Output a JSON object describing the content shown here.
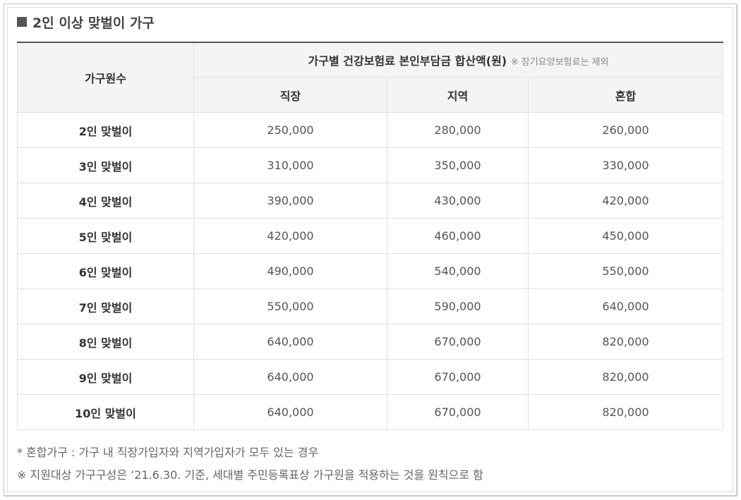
{
  "heading": "2인 이상 맞벌이 가구",
  "table": {
    "row_header_label": "가구원수",
    "group_header": "가구별 건강보험료 본인부담금 합산액(원)",
    "group_note": "※ 장기요양보험료는 제외",
    "columns": [
      "직장",
      "지역",
      "혼합"
    ],
    "rows": [
      {
        "label": "2인 맞벌이",
        "values": [
          "250,000",
          "280,000",
          "260,000"
        ]
      },
      {
        "label": "3인 맞벌이",
        "values": [
          "310,000",
          "350,000",
          "330,000"
        ]
      },
      {
        "label": "4인 맞벌이",
        "values": [
          "390,000",
          "430,000",
          "420,000"
        ]
      },
      {
        "label": "5인 맞벌이",
        "values": [
          "420,000",
          "460,000",
          "450,000"
        ]
      },
      {
        "label": "6인 맞벌이",
        "values": [
          "490,000",
          "540,000",
          "550,000"
        ]
      },
      {
        "label": "7인 맞벌이",
        "values": [
          "550,000",
          "590,000",
          "640,000"
        ]
      },
      {
        "label": "8인 맞벌이",
        "values": [
          "640,000",
          "670,000",
          "820,000"
        ]
      },
      {
        "label": "9인 맞벌이",
        "values": [
          "640,000",
          "670,000",
          "820,000"
        ]
      },
      {
        "label": "10인 맞벌이",
        "values": [
          "640,000",
          "670,000",
          "820,000"
        ]
      }
    ]
  },
  "footnotes": [
    "* 혼합가구 : 가구 내 직장가입자와 지역가입자가 모두 있는 경우",
    "※ 지원대상 가구구성은 ’21.6.30. 기준, 세대별 주민등록표상 가구원을 적용하는 것을 원칙으로 함"
  ]
}
